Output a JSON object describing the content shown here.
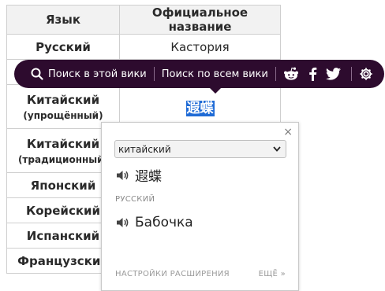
{
  "table": {
    "headers": [
      "Язык",
      "Официальное название"
    ],
    "rows": [
      {
        "lang": "Русский",
        "lang_sub": "",
        "name": "Кастория"
      },
      {
        "lang": "",
        "lang_sub": "",
        "name": ""
      },
      {
        "lang": "Китайский",
        "lang_sub": "(упрощённый)",
        "name": "遐蝶"
      },
      {
        "lang": "Китайский",
        "lang_sub": "(традиционный)",
        "name": ""
      },
      {
        "lang": "Японский",
        "lang_sub": "",
        "name": ""
      },
      {
        "lang": "Корейский",
        "lang_sub": "",
        "name": ""
      },
      {
        "lang": "Испанский",
        "lang_sub": "",
        "name": ""
      },
      {
        "lang": "Французский",
        "lang_sub": "",
        "name": ""
      }
    ]
  },
  "toolbar": {
    "search_this_wiki": "Поиск в этой вики",
    "search_all_wikis": "Поиск по всем вики",
    "icons": [
      "search-icon",
      "reddit-icon",
      "facebook-icon",
      "twitter-icon",
      "gear-icon"
    ],
    "bg_color": "#2d0b2e"
  },
  "popup": {
    "close": "×",
    "source_language": "китайский",
    "source_text": "遐蝶",
    "target_language_label": "РУССКИЙ",
    "target_text": "Бабочка",
    "settings_label": "НАСТРОЙКИ РАСШИРЕНИЯ",
    "more_label": "ЕЩЁ »"
  },
  "colors": {
    "selection": "#1f6bd6",
    "toolbar": "#2d0b2e"
  }
}
